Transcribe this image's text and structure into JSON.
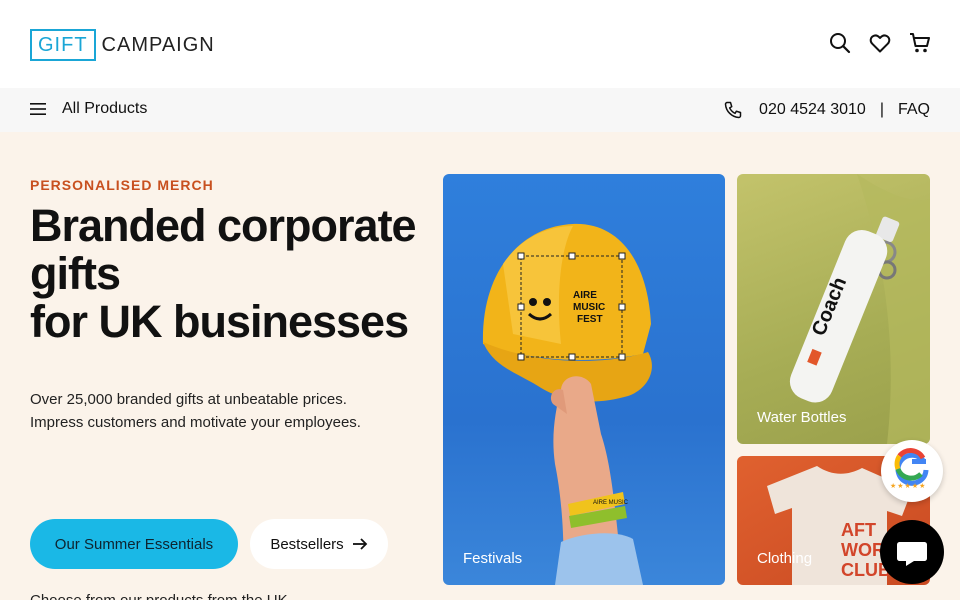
{
  "header": {
    "logo_box": "GIFT",
    "logo_text": "CAMPAIGN",
    "icons": [
      "search-icon",
      "heart-icon",
      "cart-icon"
    ]
  },
  "subnav": {
    "menu_label": "All Products",
    "phone": "020 4524 3010",
    "separator": "|",
    "faq": "FAQ"
  },
  "hero": {
    "eyebrow": "PERSONALISED MERCH",
    "headline_line1": "Branded corporate gifts",
    "headline_line2": "for UK businesses",
    "lead_line1": "Over 25,000 branded gifts at unbeatable prices.",
    "lead_line2": "Impress customers and motivate your employees.",
    "primary_cta": "Our Summer Essentials",
    "secondary_cta": "Bestsellers",
    "below_text": "Choose from our products from the UK..."
  },
  "tiles": {
    "festivals": {
      "label": "Festivals",
      "cap_text_1": "AIRE",
      "cap_text_2": "MUSIC",
      "cap_text_3": "FEST",
      "wristband_text": "AIRE MUSIC"
    },
    "bottles": {
      "label": "Water Bottles",
      "bottle_text": "Coach"
    },
    "clothing": {
      "label": "Clothing",
      "shirt_text_1": "AFT",
      "shirt_text_2": "WOR",
      "shirt_text_3": "CLUB"
    }
  },
  "widgets": {
    "google_rating": "★★★★★"
  },
  "colors": {
    "accent": "#1ab8e6",
    "eyebrow": "#c8501f",
    "hero_bg": "#fbf3ea"
  }
}
